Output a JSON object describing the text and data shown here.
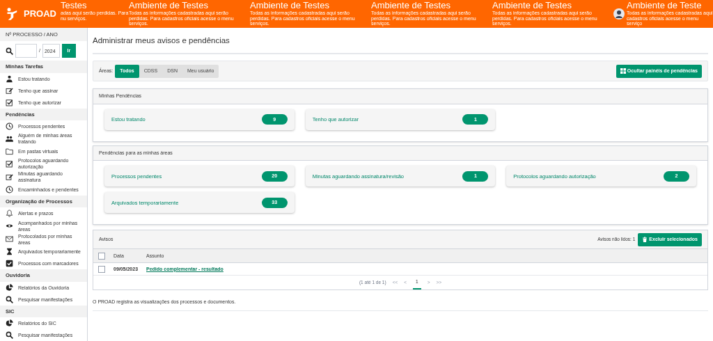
{
  "header": {
    "logo": "PROAD",
    "banners": [
      {
        "title": "Testes",
        "text": "adas aqui serão perdidas. Para nu serviços."
      },
      {
        "title": "Ambiente de Testes",
        "text": "Todas as informações cadastradas aqui serão perdidas. Para cadastros oficiais acesse o menu serviços."
      },
      {
        "title": "Ambiente de Testes",
        "text": "Todas as informações cadastradas aqui serão perdidas. Para cadastros oficiais acesse o menu serviços."
      },
      {
        "title": "Ambiente de Testes",
        "text": "Todas as informações cadastradas aqui serão perdidas. Para cadastros oficiais acesse o menu serviços."
      },
      {
        "title": "Ambiente de Testes",
        "text": "Todas as informações cadastradas aqui serão perdidas. Para cadastros oficiais acesse o menu serviços."
      },
      {
        "title": "Ambiente de Teste",
        "text": "Todas as informações cadastradas aqui cadastros oficiais acesse o menu serviço"
      }
    ]
  },
  "sidebar": {
    "search": {
      "label": "Nº PROCESSO / ANO",
      "separator": "/",
      "year": "2024",
      "button": "Ir"
    },
    "sections": [
      {
        "title": "Minhas Tarefas",
        "items": [
          {
            "kind": "user",
            "label": "Estou tratando"
          },
          {
            "kind": "edit",
            "label": "Tenho que assinar"
          },
          {
            "kind": "check",
            "label": "Tenho que autorizar"
          }
        ]
      },
      {
        "title": "Pendências",
        "items": [
          {
            "kind": "clock",
            "label": "Processos pendentes"
          },
          {
            "kind": "users",
            "label": "Alguém de minhas áreas tratando"
          },
          {
            "kind": "folder",
            "label": "Em pastas virtuais"
          },
          {
            "kind": "check",
            "label": "Protocolos aguardando autorização"
          },
          {
            "kind": "edit",
            "label": "Minutas aguardando assinatura"
          },
          {
            "kind": "clock",
            "label": "Encaminhados e pendentes"
          }
        ]
      },
      {
        "title": "Organização de Processos",
        "items": [
          {
            "kind": "bell",
            "label": "Alertas e prazos"
          },
          {
            "kind": "eye",
            "label": "Acompanhados por minhas áreas"
          },
          {
            "kind": "mail",
            "label": "Protocolados por minhas áreas"
          },
          {
            "kind": "hourglass",
            "label": "Arquivados temporariamente"
          },
          {
            "kind": "checkbox",
            "label": "Processos com marcadores"
          }
        ]
      },
      {
        "title": "Ouvidoria",
        "items": [
          {
            "kind": "pie",
            "label": "Relatórios da Ouvidoria"
          },
          {
            "kind": "search",
            "label": "Pesquisar manifestações"
          }
        ]
      },
      {
        "title": "SIC",
        "items": [
          {
            "kind": "pie",
            "label": "Relatórios do SIC"
          },
          {
            "kind": "search",
            "label": "Pesquisar manifestações"
          }
        ]
      }
    ]
  },
  "main": {
    "title": "Administrar meus avisos e pendências",
    "areas": {
      "label": "Áreas:",
      "tabs": [
        {
          "label": "Todos",
          "selected": true
        },
        {
          "label": "CDSS",
          "selected": false
        },
        {
          "label": "DSN",
          "selected": false
        },
        {
          "label": "Meu usuário",
          "selected": false
        }
      ],
      "button": "Ocultar painéis de pendências"
    },
    "panels": [
      {
        "title": "Minhas Pendências",
        "cards": [
          {
            "label": "Estou tratando",
            "count": "9"
          },
          {
            "label": "Tenho que autorizar",
            "count": "1"
          }
        ]
      },
      {
        "title": "Pendências para as minhas áreas",
        "cards": [
          {
            "label": "Processos pendentes",
            "count": "20"
          },
          {
            "label": "Minutas aguardando assinatura/revisão",
            "count": "1"
          },
          {
            "label": "Protocolos aguardando autorização",
            "count": "2"
          },
          {
            "label": "Arquivados temporariamente",
            "count": "33"
          }
        ]
      }
    ],
    "avisos": {
      "title": "Avisos",
      "select_all_checked": false,
      "unread": "Avisos não lidos: 1",
      "button": "Excluir selecionados",
      "columns": [
        "Data",
        "Assunto"
      ],
      "rows": [
        {
          "checked": false,
          "date": "09/05/2023",
          "subject": "Pedido complementar - resultado"
        }
      ],
      "pagination": {
        "summary": "(1 até 1 de 1)",
        "first": "<<",
        "prev": "<",
        "pages": [
          {
            "label": "1",
            "selected": true
          }
        ],
        "next": ">",
        "last": ">>"
      }
    },
    "footer": "O PROAD registra as visualizações dos processos e documentos."
  }
}
